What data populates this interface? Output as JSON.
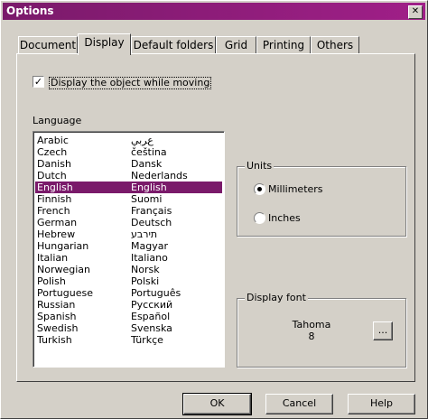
{
  "window": {
    "title": "Options",
    "close_glyph": "✕"
  },
  "tabs": [
    {
      "label": "Document"
    },
    {
      "label": "Display",
      "active": true
    },
    {
      "label": "Default folders"
    },
    {
      "label": "Grid"
    },
    {
      "label": "Printing"
    },
    {
      "label": "Others"
    }
  ],
  "display_object": {
    "checked": true,
    "check_glyph": "✓",
    "label": "Display the object while moving"
  },
  "language": {
    "label": "Language",
    "selected": "English",
    "items": [
      {
        "name": "Arabic",
        "native": "ﻉﺮﺑﻲ"
      },
      {
        "name": "Czech",
        "native": "čeština"
      },
      {
        "name": "Danish",
        "native": "Dansk"
      },
      {
        "name": "Dutch",
        "native": "Nederlands"
      },
      {
        "name": "English",
        "native": "English"
      },
      {
        "name": "Finnish",
        "native": "Suomi"
      },
      {
        "name": "French",
        "native": "Français"
      },
      {
        "name": "German",
        "native": "Deutsch"
      },
      {
        "name": "Hebrew",
        "native": "תירבע"
      },
      {
        "name": "Hungarian",
        "native": "Magyar"
      },
      {
        "name": "Italian",
        "native": "Italiano"
      },
      {
        "name": "Norwegian",
        "native": "Norsk"
      },
      {
        "name": "Polish",
        "native": "Polski"
      },
      {
        "name": "Portuguese",
        "native": "Português"
      },
      {
        "name": "Russian",
        "native": "Русский"
      },
      {
        "name": "Spanish",
        "native": "Español"
      },
      {
        "name": "Swedish",
        "native": "Svenska"
      },
      {
        "name": "Turkish",
        "native": "Türkçe"
      }
    ]
  },
  "units": {
    "title": "Units",
    "selected": "Millimeters",
    "options": [
      {
        "label": "Millimeters"
      },
      {
        "label": "Inches"
      }
    ]
  },
  "display_font": {
    "title": "Display font",
    "name": "Tahoma",
    "size": "8",
    "browse_label": "..."
  },
  "buttons": {
    "ok": "OK",
    "cancel": "Cancel",
    "help": "Help"
  },
  "colors": {
    "accent": "#7a1a6a",
    "face": "#d4d0c8"
  }
}
